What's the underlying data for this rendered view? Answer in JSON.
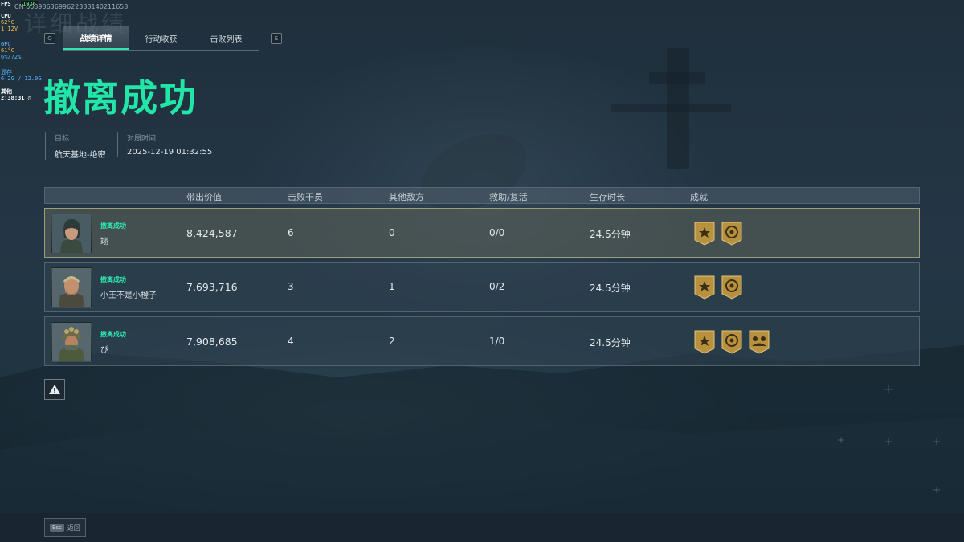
{
  "hud": {
    "fps_label": "FPS",
    "fps_value": "1026",
    "client_id": "CN 6689363699622333140211653",
    "cpu_label": "CPU",
    "cpu_temp": "62°C",
    "cpu_volt": "1.12V",
    "gpu_label": "GPU",
    "gpu_temp": "61°C",
    "gpu_usage": "6%/72%",
    "vram_label": "显存",
    "vram_value": "6.2G / 12.0G",
    "other_label": "其他",
    "clock": "2:38:31"
  },
  "background_title": "详细战绩",
  "tabs": {
    "key_left": "Q",
    "key_right": "E",
    "items": [
      {
        "label": "战绩详情",
        "active": true
      },
      {
        "label": "行动收获",
        "active": false
      },
      {
        "label": "击败列表",
        "active": false
      }
    ]
  },
  "result_title": "撤离成功",
  "match_info": {
    "target_label": "目标",
    "target_value": "航天基地-绝密",
    "time_label": "对局时间",
    "time_value": "2025-12-19 01:32:55"
  },
  "table": {
    "headers": [
      "带出价值",
      "击败干员",
      "其他敌方",
      "救助/复活",
      "生存时长",
      "成就"
    ],
    "rows": [
      {
        "status": "撤离成功",
        "name": "翊",
        "value": "8,424,587",
        "kills": "6",
        "other": "0",
        "assist": "0/0",
        "survival": "24.5分钟",
        "badges": [
          "star-badge-icon",
          "coin-badge-icon"
        ],
        "highlight": true
      },
      {
        "status": "撤离成功",
        "name": "小王不是小橙子",
        "value": "7,693,716",
        "kills": "3",
        "other": "1",
        "assist": "0/2",
        "survival": "24.5分钟",
        "badges": [
          "star-badge-icon",
          "coin-badge-icon"
        ],
        "highlight": false
      },
      {
        "status": "撤离成功",
        "name": "ぴ",
        "value": "7,908,685",
        "kills": "4",
        "other": "2",
        "assist": "1/0",
        "survival": "24.5分钟",
        "badges": [
          "star-badge-icon",
          "coin-badge-icon",
          "team-badge-icon"
        ],
        "highlight": false
      }
    ]
  },
  "footer": {
    "esc_key": "Esc",
    "back_label": "返回"
  },
  "colors": {
    "accent_green": "#22e6a8",
    "badge_gold": "#c9a24d",
    "highlight_border": "#cdc896"
  }
}
